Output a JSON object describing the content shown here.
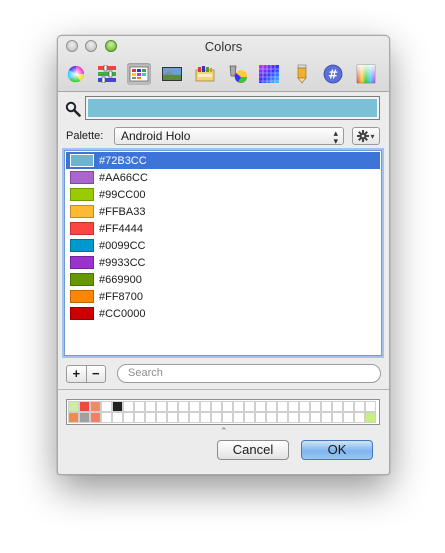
{
  "window": {
    "title": "Colors"
  },
  "toolbar": {
    "icons": [
      "color-wheel-icon",
      "color-sliders-icon",
      "color-palettes-icon",
      "image-palettes-icon",
      "crayons-icon",
      "spectrum-icon",
      "grid-icon",
      "pencil-icon",
      "hex-icon",
      "gradient-icon"
    ],
    "selected_index": 2
  },
  "current_color": "#7BC0D6",
  "palette": {
    "label": "Palette:",
    "selected": "Android Holo"
  },
  "colors": [
    {
      "hex": "#72B3CC",
      "label": "#72B3CC"
    },
    {
      "hex": "#AA66CC",
      "label": "#AA66CC"
    },
    {
      "hex": "#99CC00",
      "label": "#99CC00"
    },
    {
      "hex": "#FFBA33",
      "label": "#FFBA33"
    },
    {
      "hex": "#FF4444",
      "label": "#FF4444"
    },
    {
      "hex": "#0099CC",
      "label": "#0099CC"
    },
    {
      "hex": "#9933CC",
      "label": "#9933CC"
    },
    {
      "hex": "#669900",
      "label": "#669900"
    },
    {
      "hex": "#FF8700",
      "label": "#FF8700"
    },
    {
      "hex": "#CC0000",
      "label": "#CC0000"
    }
  ],
  "selected_color_index": 0,
  "controls": {
    "add": "+",
    "remove": "−",
    "search_placeholder": "Search"
  },
  "swatch_well": {
    "row1": [
      "#C8F0A0",
      "#E74C3C",
      "#F08A60",
      "#FFFFFF",
      "#222222"
    ],
    "row2": [
      "#F08A50",
      "#A0A0A0",
      "#F08060"
    ],
    "row2_end": [
      "#C8F080"
    ]
  },
  "buttons": {
    "cancel": "Cancel",
    "ok": "OK"
  },
  "accent": "#3C74D8"
}
